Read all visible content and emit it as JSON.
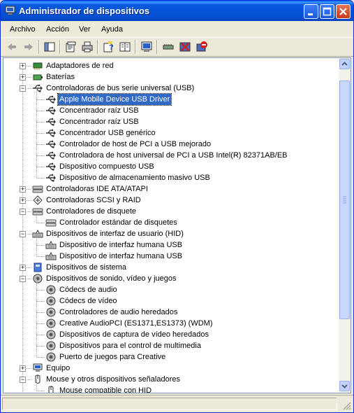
{
  "window": {
    "title": "Administrador de dispositivos"
  },
  "menu": [
    "Archivo",
    "Acción",
    "Ver",
    "Ayuda"
  ],
  "tree": [
    {
      "label": "Adaptadores de red",
      "icon": "network-adapter-icon",
      "level": 0,
      "expander": "+"
    },
    {
      "label": "Baterías",
      "icon": "battery-icon",
      "level": 0,
      "expander": "+"
    },
    {
      "label": "Controladoras de bus serie universal (USB)",
      "icon": "usb-icon",
      "level": 0,
      "expander": "-"
    },
    {
      "label": "Apple Mobile Device USB Driver",
      "icon": "usb-icon",
      "level": 1,
      "selected": true
    },
    {
      "label": "Concentrador raíz USB",
      "icon": "usb-icon",
      "level": 1
    },
    {
      "label": "Concentrador raíz USB",
      "icon": "usb-icon",
      "level": 1
    },
    {
      "label": "Concentrador USB genérico",
      "icon": "usb-icon",
      "level": 1
    },
    {
      "label": "Controlador de host de PCI a USB mejorado",
      "icon": "usb-icon",
      "level": 1
    },
    {
      "label": "Controladora de host universal de PCI a USB Intel(R) 82371AB/EB",
      "icon": "usb-icon",
      "level": 1
    },
    {
      "label": "Dispositivo compuesto USB",
      "icon": "usb-icon",
      "level": 1
    },
    {
      "label": "Dispositivo de almacenamiento masivo USB",
      "icon": "usb-icon",
      "level": 1
    },
    {
      "label": "Controladoras IDE ATA/ATAPI",
      "icon": "ide-controller-icon",
      "level": 0,
      "expander": "+"
    },
    {
      "label": "Controladoras SCSI y RAID",
      "icon": "scsi-icon",
      "level": 0,
      "expander": "+"
    },
    {
      "label": "Controladores de disquete",
      "icon": "floppy-controller-icon",
      "level": 0,
      "expander": "-"
    },
    {
      "label": "Controlador estándar de disquetes",
      "icon": "floppy-controller-icon",
      "level": 1
    },
    {
      "label": "Dispositivos de interfaz de usuario (HID)",
      "icon": "hid-icon",
      "level": 0,
      "expander": "-"
    },
    {
      "label": "Dispositivo de interfaz humana USB",
      "icon": "hid-icon",
      "level": 1
    },
    {
      "label": "Dispositivo de interfaz humana USB",
      "icon": "hid-icon",
      "level": 1
    },
    {
      "label": "Dispositivos de sistema",
      "icon": "system-device-icon",
      "level": 0,
      "expander": "+"
    },
    {
      "label": "Dispositivos de sonido, vídeo y juegos",
      "icon": "sound-icon",
      "level": 0,
      "expander": "-"
    },
    {
      "label": "Códecs de audio",
      "icon": "sound-icon",
      "level": 1
    },
    {
      "label": "Códecs de vídeo",
      "icon": "sound-icon",
      "level": 1
    },
    {
      "label": "Controladores de audio heredados",
      "icon": "sound-icon",
      "level": 1
    },
    {
      "label": "Creative AudioPCI (ES1371,ES1373) (WDM)",
      "icon": "sound-icon",
      "level": 1
    },
    {
      "label": "Dispositivos de captura de vídeo heredados",
      "icon": "sound-icon",
      "level": 1
    },
    {
      "label": "Dispositivos para el control de multimedia",
      "icon": "sound-icon",
      "level": 1
    },
    {
      "label": "Puerto de juegos para Creative",
      "icon": "sound-icon",
      "level": 1
    },
    {
      "label": "Equipo",
      "icon": "computer-icon",
      "level": 0,
      "expander": "+"
    },
    {
      "label": "Mouse y otros dispositivos señaladores",
      "icon": "mouse-icon",
      "level": 0,
      "expander": "-"
    },
    {
      "label": "Mouse compatible con HID",
      "icon": "mouse-icon",
      "level": 1
    }
  ],
  "toolbar": [
    "back-icon",
    "forward-icon",
    "show-hide-tree-icon",
    "properties-icon",
    "print-icon",
    "help-icon",
    "view-icon",
    "scan-hardware-icon",
    "update-driver-icon",
    "uninstall-icon",
    "disable-icon"
  ]
}
